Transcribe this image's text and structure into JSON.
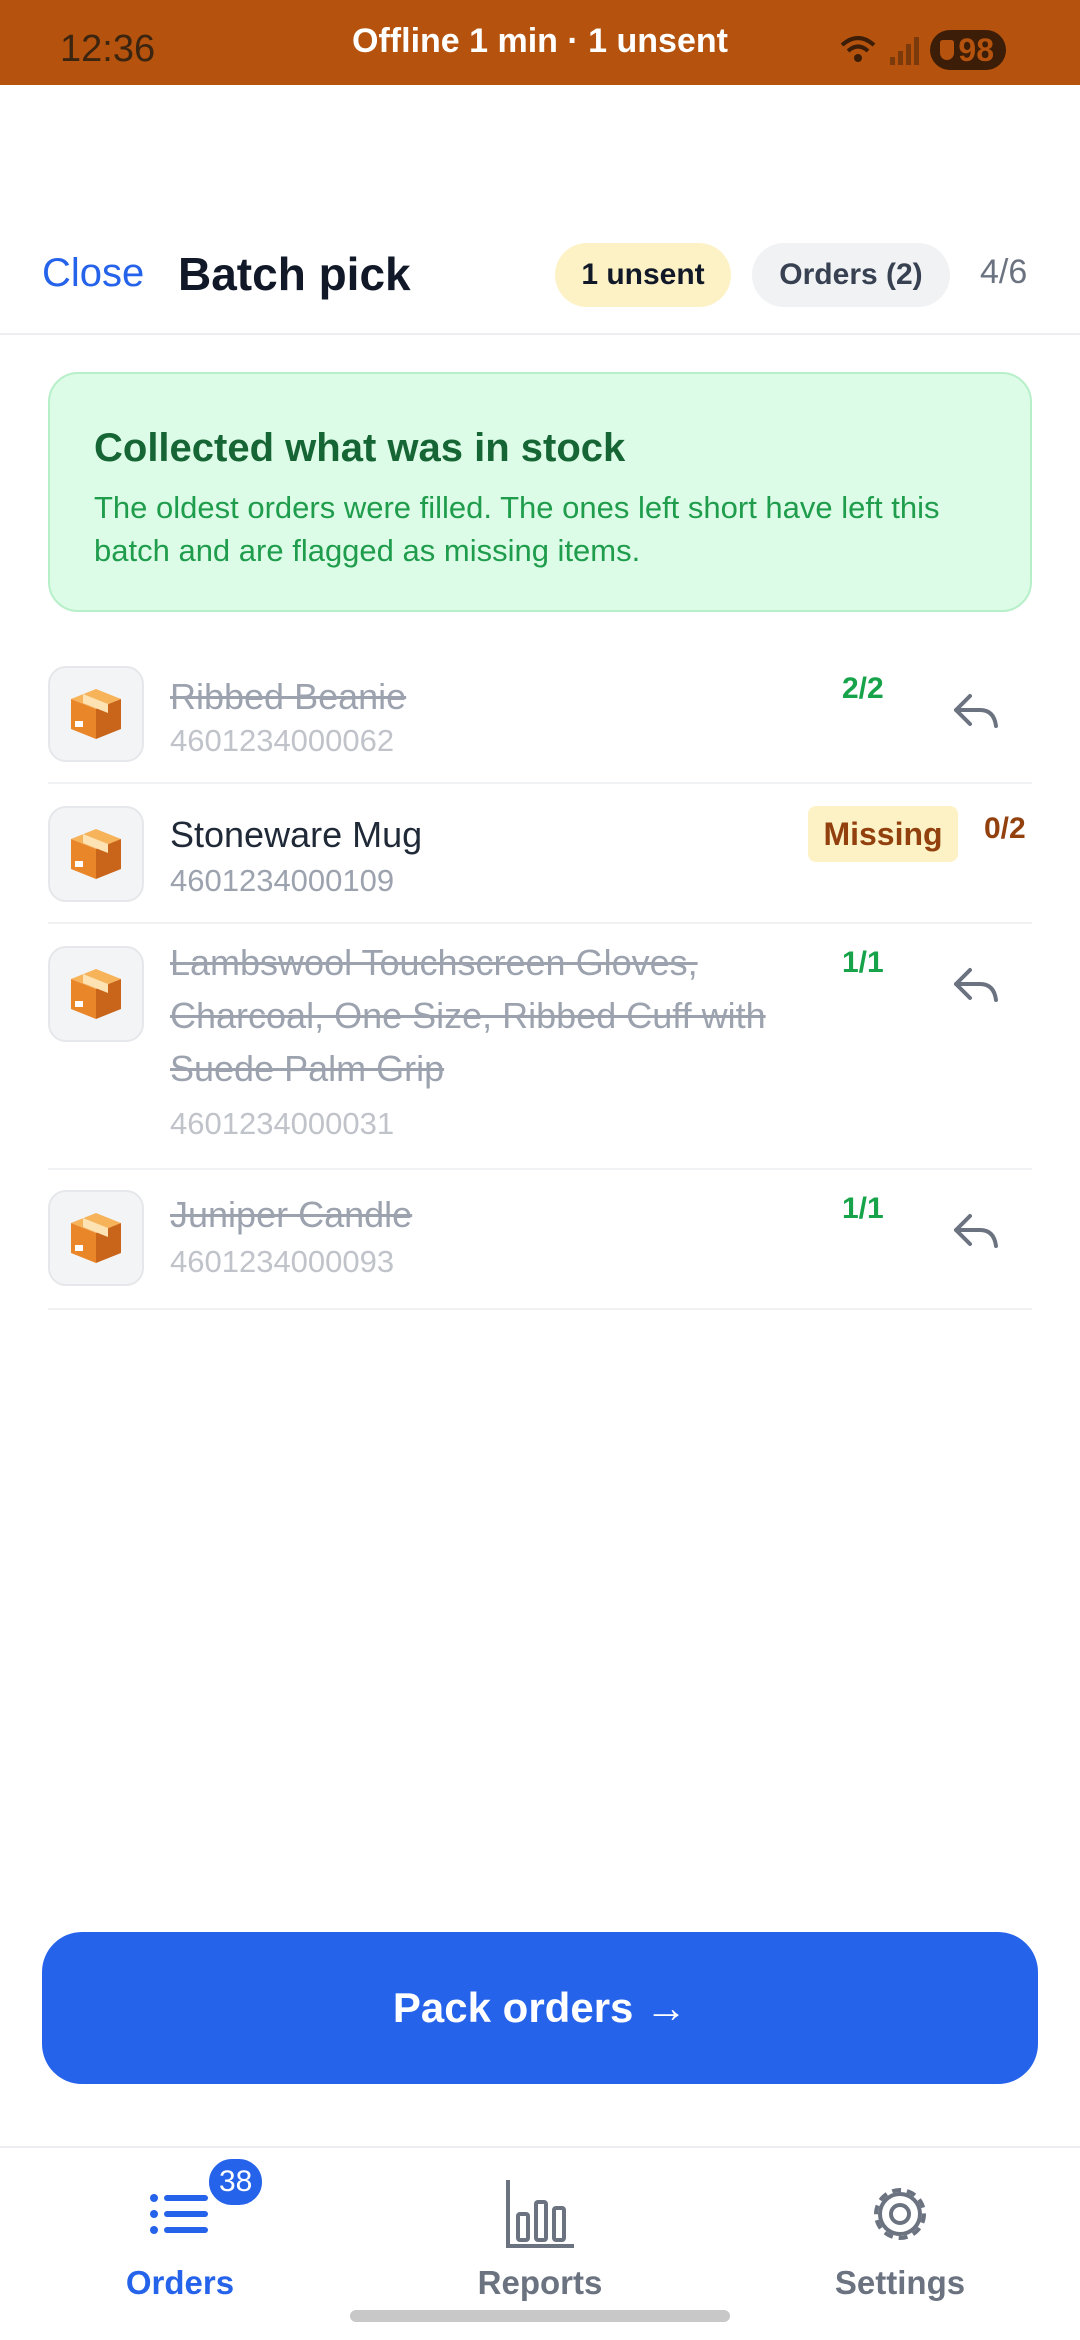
{
  "status_bar": {
    "time": "12:36",
    "center_text": "Offline 1 min · 1 unsent",
    "battery": "98"
  },
  "header": {
    "close_label": "Close",
    "title": "Batch pick",
    "unsent_chip": "1 unsent",
    "orders_chip": "Orders (2)",
    "progress": "4/6"
  },
  "banner": {
    "title": "Collected what was in stock",
    "text": "The oldest orders were filled. The ones left short have left this batch and are flagged as missing items."
  },
  "items": [
    {
      "name": "Ribbed Beanie",
      "sku": "4601234000062",
      "qty": "2/2",
      "status": "picked"
    },
    {
      "name": "Stoneware Mug",
      "sku": "4601234000109",
      "qty": "0/2",
      "status": "missing",
      "badge": "Missing"
    },
    {
      "name": "Lambswool Touchscreen Gloves, Charcoal, One Size, Ribbed Cuff with Suede Palm Grip",
      "sku": "4601234000031",
      "qty": "1/1",
      "status": "picked"
    },
    {
      "name": "Juniper Candle",
      "sku": "4601234000093",
      "qty": "1/1",
      "status": "picked"
    }
  ],
  "pack_button": "Pack orders →",
  "bottom_nav": {
    "orders": {
      "label": "Orders",
      "badge": "38",
      "icon": "list-icon"
    },
    "reports": {
      "label": "Reports",
      "icon": "bar-chart-icon"
    },
    "settings": {
      "label": "Settings",
      "icon": "gear-icon"
    }
  },
  "colors": {
    "status_bar": "#b5530e",
    "accent": "#2563eb",
    "success": "#16a34a",
    "warning": "#92400e"
  }
}
